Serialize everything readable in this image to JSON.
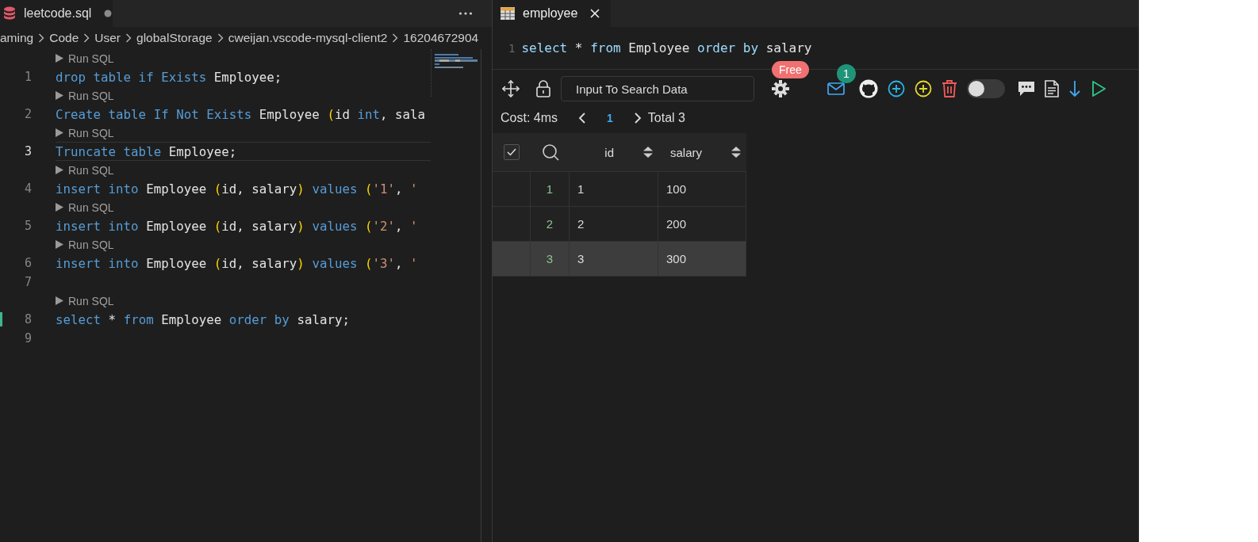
{
  "editor": {
    "tab": {
      "title": "leetcode.sql",
      "unsaved": true
    },
    "breadcrumb": [
      "aming",
      "Code",
      "User",
      "globalStorage",
      "cweijan.vscode-mysql-client2",
      "16204672904"
    ],
    "lines": [
      {
        "number": "1",
        "run_label": "Run SQL",
        "current": false,
        "modified": false,
        "tokens": [
          {
            "kind": "keyword",
            "text": "drop table if Exists"
          },
          {
            "kind": "plain",
            "text": " Employee;"
          }
        ]
      },
      {
        "number": "2",
        "run_label": "Run SQL",
        "current": false,
        "modified": false,
        "tokens": [
          {
            "kind": "keyword",
            "text": "Create table If Not Exists"
          },
          {
            "kind": "plain",
            "text": " Employee "
          },
          {
            "kind": "paren",
            "text": "("
          },
          {
            "kind": "plain",
            "text": "id "
          },
          {
            "kind": "keyword",
            "text": "int"
          },
          {
            "kind": "plain",
            "text": ", sala"
          }
        ]
      },
      {
        "number": "3",
        "run_label": "Run SQL",
        "current": true,
        "modified": false,
        "tokens": [
          {
            "kind": "keyword",
            "text": "Truncate table"
          },
          {
            "kind": "plain",
            "text": " Employee;"
          }
        ]
      },
      {
        "number": "4",
        "run_label": "Run SQL",
        "current": false,
        "modified": false,
        "tokens": [
          {
            "kind": "keyword",
            "text": "insert into"
          },
          {
            "kind": "plain",
            "text": " Employee "
          },
          {
            "kind": "paren",
            "text": "("
          },
          {
            "kind": "plain",
            "text": "id, salary"
          },
          {
            "kind": "paren",
            "text": ")"
          },
          {
            "kind": "keyword",
            "text": " values"
          },
          {
            "kind": "paren",
            "text": " ("
          },
          {
            "kind": "string",
            "text": "'1'"
          },
          {
            "kind": "plain",
            "text": ", "
          },
          {
            "kind": "string",
            "text": "'"
          }
        ]
      },
      {
        "number": "5",
        "run_label": "Run SQL",
        "current": false,
        "modified": false,
        "tokens": [
          {
            "kind": "keyword",
            "text": "insert into"
          },
          {
            "kind": "plain",
            "text": " Employee "
          },
          {
            "kind": "paren",
            "text": "("
          },
          {
            "kind": "plain",
            "text": "id, salary"
          },
          {
            "kind": "paren",
            "text": ")"
          },
          {
            "kind": "keyword",
            "text": " values"
          },
          {
            "kind": "paren",
            "text": " ("
          },
          {
            "kind": "string",
            "text": "'2'"
          },
          {
            "kind": "plain",
            "text": ", "
          },
          {
            "kind": "string",
            "text": "'"
          }
        ]
      },
      {
        "number": "6",
        "run_label": "Run SQL",
        "current": false,
        "modified": false,
        "tokens": [
          {
            "kind": "keyword",
            "text": "insert into"
          },
          {
            "kind": "plain",
            "text": " Employee "
          },
          {
            "kind": "paren",
            "text": "("
          },
          {
            "kind": "plain",
            "text": "id, salary"
          },
          {
            "kind": "paren",
            "text": ")"
          },
          {
            "kind": "keyword",
            "text": " values"
          },
          {
            "kind": "paren",
            "text": " ("
          },
          {
            "kind": "string",
            "text": "'3'"
          },
          {
            "kind": "plain",
            "text": ", "
          },
          {
            "kind": "string",
            "text": "'"
          }
        ]
      },
      {
        "number": "7",
        "current": false,
        "modified": false
      },
      {
        "number": "8",
        "run_label": "Run SQL",
        "current": false,
        "modified": true,
        "tokens": [
          {
            "kind": "keyword",
            "text": "select"
          },
          {
            "kind": "plain",
            "text": " * "
          },
          {
            "kind": "keyword",
            "text": "from"
          },
          {
            "kind": "plain",
            "text": " Employee "
          },
          {
            "kind": "keyword",
            "text": "order by"
          },
          {
            "kind": "plain",
            "text": " salary;"
          }
        ]
      },
      {
        "number": "9",
        "current": false,
        "modified": false
      }
    ]
  },
  "result_panel": {
    "tab": {
      "title": "employee"
    },
    "query": {
      "number": "1",
      "tokens": [
        {
          "kind": "keyword",
          "text": "select"
        },
        {
          "kind": "plain",
          "text": " * "
        },
        {
          "kind": "keyword",
          "text": "from"
        },
        {
          "kind": "plain",
          "text": " Employee "
        },
        {
          "kind": "keyword",
          "text": "order by"
        },
        {
          "kind": "plain",
          "text": " salary"
        }
      ]
    },
    "toolbar": {
      "search": {
        "placeholder": "Input To Search Data"
      },
      "settings_badge": "Free",
      "mail_badge": "1",
      "toggle": {
        "on": false
      }
    },
    "pagination": {
      "cost": "Cost: 4ms",
      "page": "1",
      "total": "Total 3"
    },
    "table": {
      "header_checked": true,
      "columns": [
        "id",
        "salary"
      ],
      "rows": [
        {
          "index": "1",
          "cells": [
            "1",
            "100"
          ],
          "selected": false
        },
        {
          "index": "2",
          "cells": [
            "2",
            "200"
          ],
          "selected": false
        },
        {
          "index": "3",
          "cells": [
            "3",
            "300"
          ],
          "selected": true
        }
      ]
    }
  }
}
